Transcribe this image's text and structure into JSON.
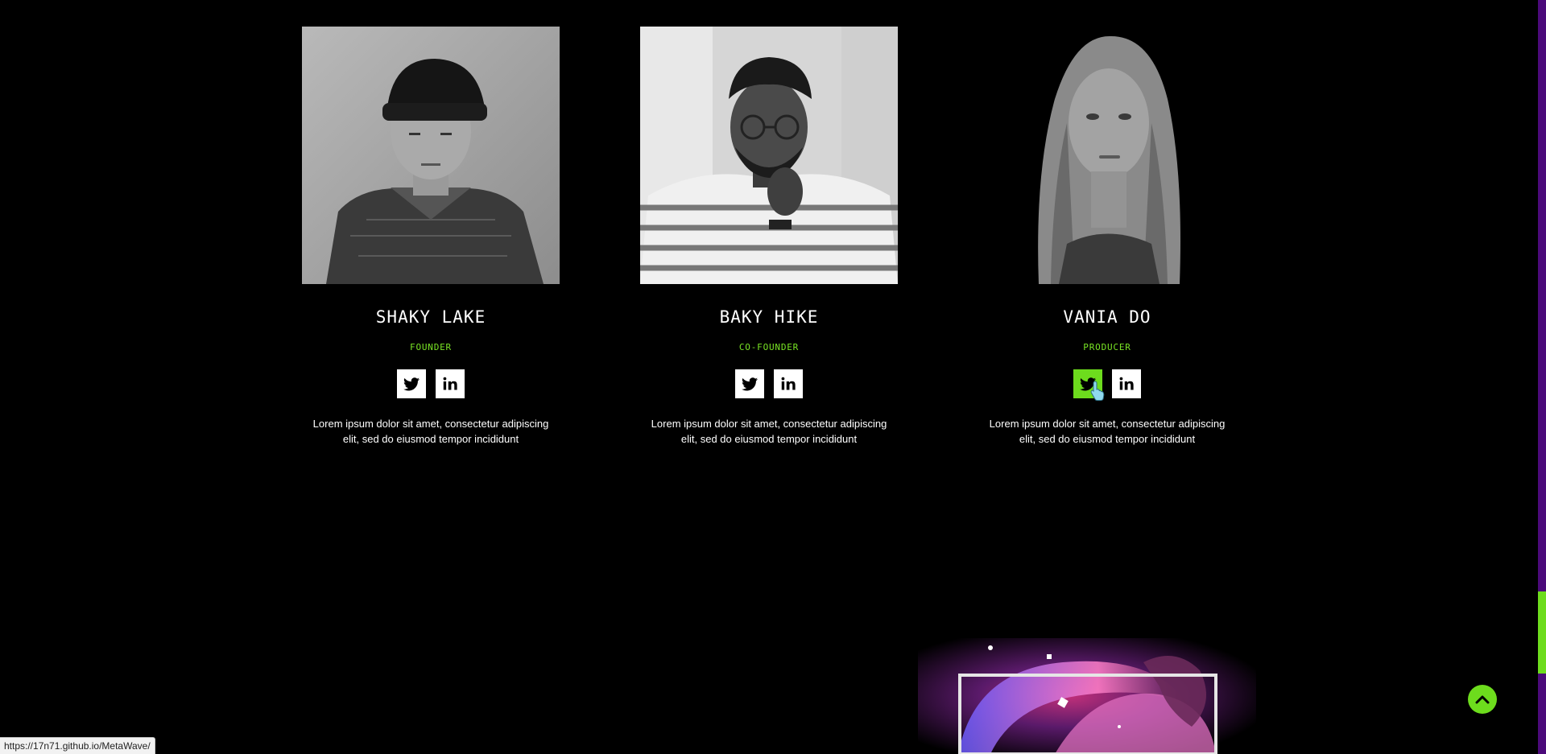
{
  "team": [
    {
      "name": "SHAKY LAKE",
      "role": "FOUNDER",
      "description": "Lorem ipsum dolor sit amet, consectetur adipiscing elit, sed do eiusmod tempor incididunt",
      "socials": [
        "twitter-icon",
        "linkedin-icon"
      ]
    },
    {
      "name": "BAKY HIKE",
      "role": "CO-FOUNDER",
      "description": "Lorem ipsum dolor sit amet, consectetur adipiscing elit, sed do eiusmod tempor incididunt",
      "socials": [
        "twitter-icon",
        "linkedin-icon"
      ]
    },
    {
      "name": "VANIA DO",
      "role": "PRODUCER",
      "description": "Lorem ipsum dolor sit amet, consectetur adipiscing elit, sed do eiusmod tempor incididunt",
      "socials": [
        "twitter-icon",
        "linkedin-icon"
      ],
      "hovered_social": "twitter-icon"
    }
  ],
  "colors": {
    "accent": "#6ddc1d",
    "background": "#000000",
    "scrollbar_track": "#4b0a7a"
  },
  "back_to_top": {
    "icon": "chevron-up-icon"
  },
  "status_bar": {
    "url": "https://17n71.github.io/MetaWave/"
  }
}
